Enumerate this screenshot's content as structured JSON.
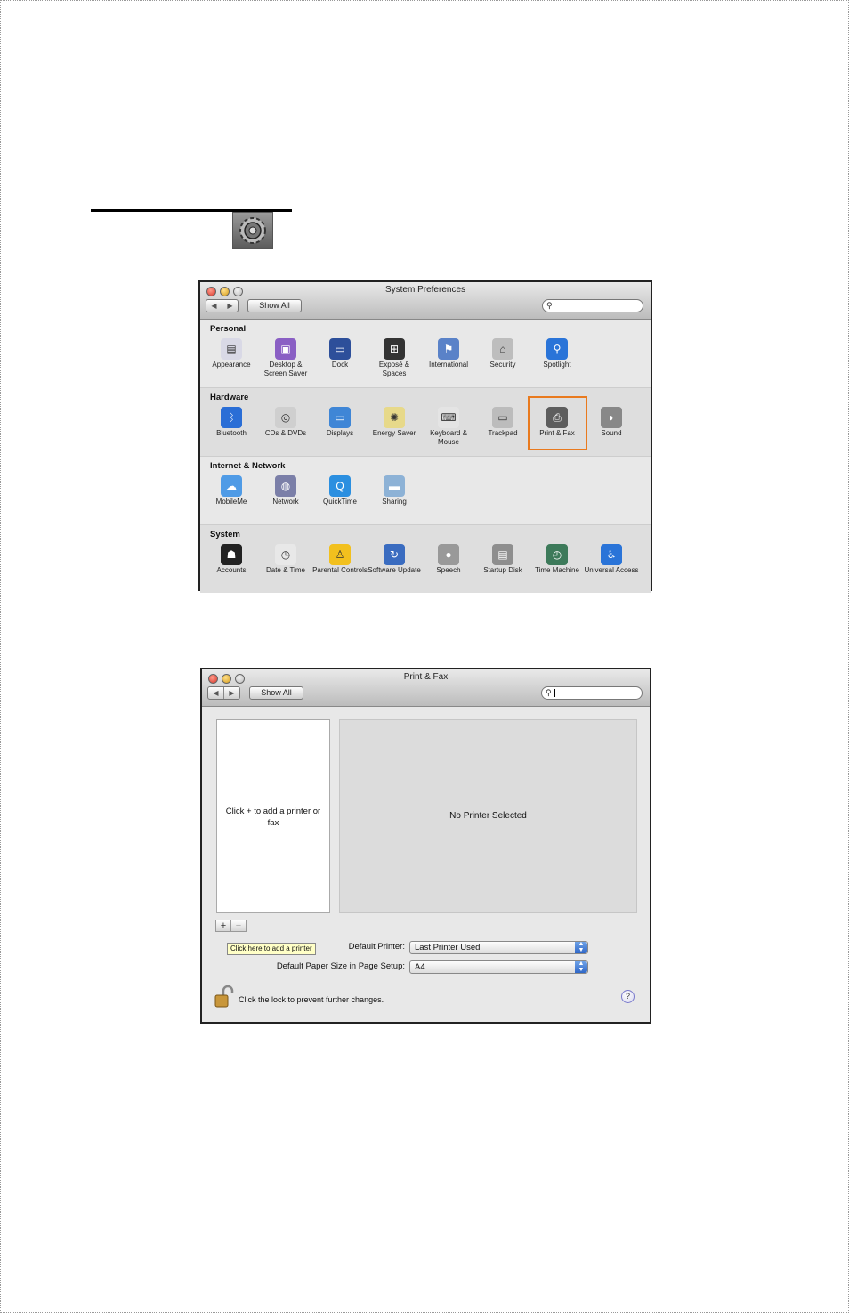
{
  "colors": {
    "highlight_border": "#e97a1e",
    "window_bg": "#e8e8e8",
    "tooltip_bg": "#ffffc6"
  },
  "prefs_window": {
    "title": "System Preferences",
    "show_all": "Show All",
    "search_placeholder": "",
    "highlighted_item": "Print & Fax",
    "sections": [
      {
        "label": "Personal",
        "items": [
          {
            "label": "Appearance",
            "icon": "appearance-icon"
          },
          {
            "label": "Desktop & Screen Saver",
            "icon": "desktop-icon"
          },
          {
            "label": "Dock",
            "icon": "dock-icon"
          },
          {
            "label": "Exposé & Spaces",
            "icon": "expose-icon"
          },
          {
            "label": "International",
            "icon": "flag-icon"
          },
          {
            "label": "Security",
            "icon": "house-safe-icon"
          },
          {
            "label": "Spotlight",
            "icon": "spotlight-icon"
          }
        ]
      },
      {
        "label": "Hardware",
        "items": [
          {
            "label": "Bluetooth",
            "icon": "bluetooth-icon"
          },
          {
            "label": "CDs & DVDs",
            "icon": "disc-icon"
          },
          {
            "label": "Displays",
            "icon": "monitor-icon"
          },
          {
            "label": "Energy Saver",
            "icon": "lightbulb-icon"
          },
          {
            "label": "Keyboard & Mouse",
            "icon": "keyboard-mouse-icon"
          },
          {
            "label": "Trackpad",
            "icon": "trackpad-icon"
          },
          {
            "label": "Print & Fax",
            "icon": "printer-icon"
          },
          {
            "label": "Sound",
            "icon": "speaker-icon"
          }
        ]
      },
      {
        "label": "Internet & Network",
        "items": [
          {
            "label": "MobileMe",
            "icon": "cloud-icon"
          },
          {
            "label": "Network",
            "icon": "globe-icon"
          },
          {
            "label": "QuickTime",
            "icon": "quicktime-icon"
          },
          {
            "label": "Sharing",
            "icon": "folder-icon"
          }
        ]
      },
      {
        "label": "System",
        "items": [
          {
            "label": "Accounts",
            "icon": "people-icon"
          },
          {
            "label": "Date & Time",
            "icon": "clock-icon"
          },
          {
            "label": "Parental Controls",
            "icon": "parental-icon"
          },
          {
            "label": "Software Update",
            "icon": "update-icon"
          },
          {
            "label": "Speech",
            "icon": "microphone-icon"
          },
          {
            "label": "Startup Disk",
            "icon": "harddisk-icon"
          },
          {
            "label": "Time Machine",
            "icon": "time-machine-icon"
          },
          {
            "label": "Universal Access",
            "icon": "accessibility-icon"
          }
        ]
      }
    ]
  },
  "pf_window": {
    "title": "Print & Fax",
    "show_all": "Show All",
    "list_hint": "Click + to add a printer or fax",
    "no_printer": "No Printer Selected",
    "add_button": "+",
    "remove_button": "−",
    "tooltip": "Click here to add a printer",
    "default_printer_label": "Default Printer:",
    "default_printer_value": "Last Printer Used",
    "paper_size_label": "Default Paper Size in Page Setup:",
    "paper_size_value": "A4",
    "lock_text": "Click the lock to prevent further changes.",
    "help": "?"
  }
}
